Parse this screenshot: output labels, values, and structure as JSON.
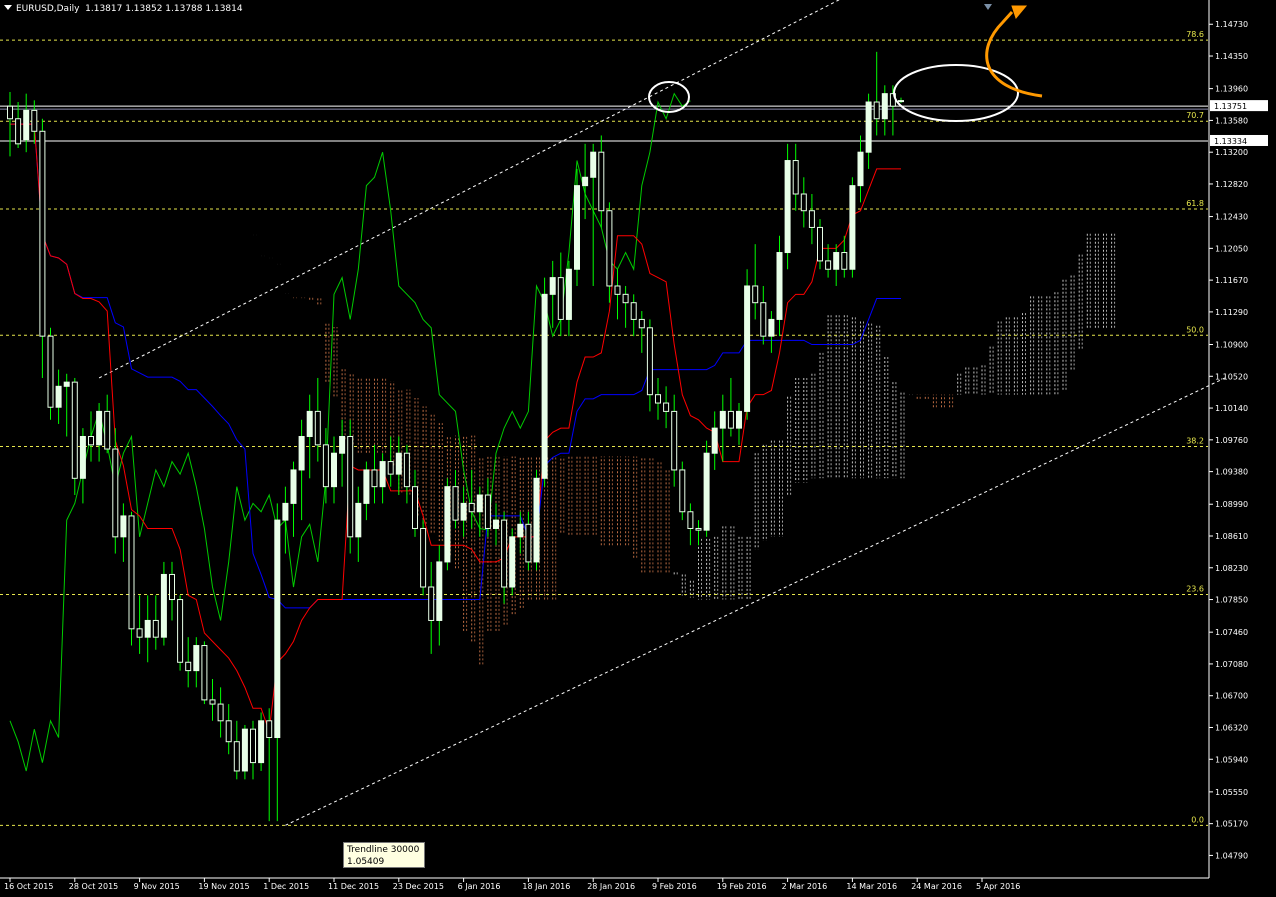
{
  "header": {
    "symbol": "EURUSD,Daily",
    "ohlc": "1.13817 1.13852 1.13788 1.13814"
  },
  "tooltip": {
    "name": "Trendline 30000",
    "value": "1.05409"
  },
  "colors": {
    "background": "#000000",
    "axis": "#ffffff",
    "candle_body": "#e8ffe8",
    "wick": "#00ff00",
    "tenkan": "#ff0000",
    "kijun": "#0000ff",
    "chikou": "#00cc00",
    "cloud": "#e8e8e8",
    "cloud_bear": "#e08050",
    "fib": "#e6e64c",
    "trendline": "#ffffff",
    "circle": "#ffffff",
    "arrow": "#ff9900"
  },
  "chart_data": {
    "type": "candlestick",
    "title": "EURUSD,Daily",
    "ohlc_last": [
      1.13817,
      1.13852,
      1.13788,
      1.13814
    ],
    "ylim": [
      1.0452,
      1.1502
    ],
    "y_ticks": [
      1.1473,
      1.1435,
      1.1396,
      1.1358,
      1.132,
      1.1282,
      1.1243,
      1.1205,
      1.1167,
      1.1129,
      1.109,
      1.1052,
      1.1014,
      1.0976,
      1.0938,
      1.0899,
      1.0861,
      1.0823,
      1.0785,
      1.0746,
      1.0708,
      1.067,
      1.0632,
      1.0594,
      1.0555,
      1.0517,
      1.0479
    ],
    "y_tick_labels": [
      "1.14730",
      "1.14350",
      "1.13960",
      "1.13580",
      "1.13200",
      "1.12820",
      "1.12430",
      "1.12050",
      "1.11670",
      "1.11290",
      "1.10900",
      "1.10520",
      "1.10140",
      "1.09760",
      "1.09380",
      "1.08990",
      "1.08610",
      "1.08230",
      "1.07850",
      "1.07460",
      "1.07080",
      "1.06700",
      "1.06320",
      "1.05940",
      "1.05550",
      "1.05170",
      "1.04790"
    ],
    "x_tick_labels": [
      "16 Oct 2015",
      "28 Oct 2015",
      "9 Nov 2015",
      "19 Nov 2015",
      "1 Dec 2015",
      "11 Dec 2015",
      "23 Dec 2015",
      "6 Jan 2016",
      "18 Jan 2016",
      "28 Jan 2016",
      "9 Feb 2016",
      "19 Feb 2016",
      "2 Mar 2016",
      "14 Mar 2016",
      "24 Mar 2016",
      "5 Apr 2016"
    ],
    "x_tick_bars": [
      0,
      8,
      16,
      24,
      32,
      40,
      48,
      56,
      64,
      72,
      80,
      88,
      96,
      104,
      112,
      120
    ],
    "price_labels": [
      {
        "value": 1.13751,
        "label": "1.13751"
      },
      {
        "value": 1.13334,
        "label": "1.13334"
      }
    ],
    "horizontal_lines": [
      1.13751,
      1.13334
    ],
    "fib_levels": [
      {
        "label": "78.6",
        "value": 1.1454
      },
      {
        "label": "70.7",
        "value": 1.1357
      },
      {
        "label": "61.8",
        "value": 1.1252
      },
      {
        "label": "50.0",
        "value": 1.1101
      },
      {
        "label": "38.2",
        "value": 1.0968
      },
      {
        "label": "23.6",
        "value": 1.0791
      },
      {
        "label": "0.0",
        "value": 1.0515
      }
    ],
    "trendlines": [
      {
        "name": "upper-channel",
        "x": [
          11,
          110
        ],
        "y": [
          1.105,
          1.154
        ]
      },
      {
        "name": "lower-channel",
        "x": [
          34,
          150
        ],
        "y": [
          1.0515,
          1.105
        ]
      }
    ],
    "candles": [
      {
        "o": 1.1375,
        "h": 1.1392,
        "l": 1.1315,
        "c": 1.136
      },
      {
        "o": 1.136,
        "h": 1.138,
        "l": 1.1325,
        "c": 1.133
      },
      {
        "o": 1.1335,
        "h": 1.139,
        "l": 1.132,
        "c": 1.137
      },
      {
        "o": 1.137,
        "h": 1.1382,
        "l": 1.133,
        "c": 1.1345
      },
      {
        "o": 1.1345,
        "h": 1.136,
        "l": 1.105,
        "c": 1.11
      },
      {
        "o": 1.11,
        "h": 1.111,
        "l": 1.1,
        "c": 1.1015
      },
      {
        "o": 1.1015,
        "h": 1.106,
        "l": 1.0995,
        "c": 1.104
      },
      {
        "o": 1.104,
        "h": 1.1055,
        "l": 1.098,
        "c": 1.1045
      },
      {
        "o": 1.1045,
        "h": 1.105,
        "l": 1.091,
        "c": 1.093
      },
      {
        "o": 1.093,
        "h": 1.099,
        "l": 1.09,
        "c": 1.098
      },
      {
        "o": 1.098,
        "h": 1.101,
        "l": 1.095,
        "c": 1.097
      },
      {
        "o": 1.097,
        "h": 1.102,
        "l": 1.095,
        "c": 1.101
      },
      {
        "o": 1.101,
        "h": 1.103,
        "l": 1.096,
        "c": 1.0965
      },
      {
        "o": 1.0965,
        "h": 1.099,
        "l": 1.084,
        "c": 1.086
      },
      {
        "o": 1.086,
        "h": 1.09,
        "l": 1.083,
        "c": 1.0885
      },
      {
        "o": 1.0885,
        "h": 1.089,
        "l": 1.073,
        "c": 1.075
      },
      {
        "o": 1.075,
        "h": 1.079,
        "l": 1.072,
        "c": 1.074
      },
      {
        "o": 1.074,
        "h": 1.079,
        "l": 1.071,
        "c": 1.076
      },
      {
        "o": 1.076,
        "h": 1.079,
        "l": 1.0725,
        "c": 1.074
      },
      {
        "o": 1.074,
        "h": 1.083,
        "l": 1.073,
        "c": 1.0815
      },
      {
        "o": 1.0815,
        "h": 1.083,
        "l": 1.076,
        "c": 1.0785
      },
      {
        "o": 1.0785,
        "h": 1.079,
        "l": 1.07,
        "c": 1.071
      },
      {
        "o": 1.071,
        "h": 1.074,
        "l": 1.068,
        "c": 1.07
      },
      {
        "o": 1.07,
        "h": 1.074,
        "l": 1.068,
        "c": 1.073
      },
      {
        "o": 1.073,
        "h": 1.0735,
        "l": 1.066,
        "c": 1.0665
      },
      {
        "o": 1.0665,
        "h": 1.069,
        "l": 1.064,
        "c": 1.066
      },
      {
        "o": 1.066,
        "h": 1.068,
        "l": 1.062,
        "c": 1.064
      },
      {
        "o": 1.064,
        "h": 1.066,
        "l": 1.06,
        "c": 1.0615
      },
      {
        "o": 1.0615,
        "h": 1.064,
        "l": 1.057,
        "c": 1.058
      },
      {
        "o": 1.058,
        "h": 1.0635,
        "l": 1.057,
        "c": 1.063
      },
      {
        "o": 1.063,
        "h": 1.064,
        "l": 1.057,
        "c": 1.059
      },
      {
        "o": 1.059,
        "h": 1.065,
        "l": 1.058,
        "c": 1.064
      },
      {
        "o": 1.064,
        "h": 1.0655,
        "l": 1.052,
        "c": 1.062
      },
      {
        "o": 1.062,
        "h": 1.09,
        "l": 1.052,
        "c": 1.088
      },
      {
        "o": 1.088,
        "h": 1.092,
        "l": 1.084,
        "c": 1.09
      },
      {
        "o": 1.09,
        "h": 1.095,
        "l": 1.086,
        "c": 1.094
      },
      {
        "o": 1.094,
        "h": 1.1,
        "l": 1.088,
        "c": 1.098
      },
      {
        "o": 1.098,
        "h": 1.103,
        "l": 1.093,
        "c": 1.101
      },
      {
        "o": 1.101,
        "h": 1.105,
        "l": 1.095,
        "c": 1.097
      },
      {
        "o": 1.097,
        "h": 1.099,
        "l": 1.09,
        "c": 1.092
      },
      {
        "o": 1.092,
        "h": 1.098,
        "l": 1.09,
        "c": 1.096
      },
      {
        "o": 1.096,
        "h": 1.1,
        "l": 1.092,
        "c": 1.098
      },
      {
        "o": 1.098,
        "h": 1.1,
        "l": 1.084,
        "c": 1.086
      },
      {
        "o": 1.086,
        "h": 1.092,
        "l": 1.083,
        "c": 1.09
      },
      {
        "o": 1.09,
        "h": 1.095,
        "l": 1.088,
        "c": 1.094
      },
      {
        "o": 1.094,
        "h": 1.097,
        "l": 1.09,
        "c": 1.092
      },
      {
        "o": 1.092,
        "h": 1.096,
        "l": 1.09,
        "c": 1.095
      },
      {
        "o": 1.095,
        "h": 1.098,
        "l": 1.092,
        "c": 1.0935
      },
      {
        "o": 1.0935,
        "h": 1.098,
        "l": 1.091,
        "c": 1.096
      },
      {
        "o": 1.096,
        "h": 1.097,
        "l": 1.09,
        "c": 1.092
      },
      {
        "o": 1.092,
        "h": 1.094,
        "l": 1.086,
        "c": 1.087
      },
      {
        "o": 1.087,
        "h": 1.088,
        "l": 1.079,
        "c": 1.08
      },
      {
        "o": 1.08,
        "h": 1.083,
        "l": 1.072,
        "c": 1.076
      },
      {
        "o": 1.076,
        "h": 1.085,
        "l": 1.073,
        "c": 1.083
      },
      {
        "o": 1.083,
        "h": 1.093,
        "l": 1.082,
        "c": 1.092
      },
      {
        "o": 1.092,
        "h": 1.094,
        "l": 1.087,
        "c": 1.088
      },
      {
        "o": 1.088,
        "h": 1.092,
        "l": 1.086,
        "c": 1.09
      },
      {
        "o": 1.09,
        "h": 1.094,
        "l": 1.087,
        "c": 1.089
      },
      {
        "o": 1.089,
        "h": 1.092,
        "l": 1.086,
        "c": 1.091
      },
      {
        "o": 1.091,
        "h": 1.093,
        "l": 1.086,
        "c": 1.087
      },
      {
        "o": 1.087,
        "h": 1.09,
        "l": 1.085,
        "c": 1.088
      },
      {
        "o": 1.088,
        "h": 1.089,
        "l": 1.078,
        "c": 1.08
      },
      {
        "o": 1.08,
        "h": 1.087,
        "l": 1.079,
        "c": 1.086
      },
      {
        "o": 1.086,
        "h": 1.089,
        "l": 1.084,
        "c": 1.0875
      },
      {
        "o": 1.0875,
        "h": 1.089,
        "l": 1.082,
        "c": 1.083
      },
      {
        "o": 1.083,
        "h": 1.094,
        "l": 1.082,
        "c": 1.093
      },
      {
        "o": 1.093,
        "h": 1.117,
        "l": 1.092,
        "c": 1.115
      },
      {
        "o": 1.115,
        "h": 1.119,
        "l": 1.111,
        "c": 1.117
      },
      {
        "o": 1.117,
        "h": 1.12,
        "l": 1.11,
        "c": 1.112
      },
      {
        "o": 1.112,
        "h": 1.119,
        "l": 1.11,
        "c": 1.118
      },
      {
        "o": 1.118,
        "h": 1.13,
        "l": 1.116,
        "c": 1.128
      },
      {
        "o": 1.128,
        "h": 1.133,
        "l": 1.124,
        "c": 1.129
      },
      {
        "o": 1.129,
        "h": 1.133,
        "l": 1.116,
        "c": 1.132
      },
      {
        "o": 1.132,
        "h": 1.134,
        "l": 1.123,
        "c": 1.125
      },
      {
        "o": 1.125,
        "h": 1.126,
        "l": 1.114,
        "c": 1.116
      },
      {
        "o": 1.116,
        "h": 1.118,
        "l": 1.112,
        "c": 1.115
      },
      {
        "o": 1.115,
        "h": 1.116,
        "l": 1.111,
        "c": 1.114
      },
      {
        "o": 1.114,
        "h": 1.115,
        "l": 1.11,
        "c": 1.112
      },
      {
        "o": 1.112,
        "h": 1.113,
        "l": 1.108,
        "c": 1.111
      },
      {
        "o": 1.111,
        "h": 1.112,
        "l": 1.101,
        "c": 1.103
      },
      {
        "o": 1.103,
        "h": 1.105,
        "l": 1.1,
        "c": 1.102
      },
      {
        "o": 1.102,
        "h": 1.104,
        "l": 1.099,
        "c": 1.101
      },
      {
        "o": 1.101,
        "h": 1.103,
        "l": 1.092,
        "c": 1.094
      },
      {
        "o": 1.094,
        "h": 1.095,
        "l": 1.088,
        "c": 1.089
      },
      {
        "o": 1.089,
        "h": 1.09,
        "l": 1.085,
        "c": 1.087
      },
      {
        "o": 1.087,
        "h": 1.088,
        "l": 1.085,
        "c": 1.0868
      },
      {
        "o": 1.0868,
        "h": 1.0975,
        "l": 1.086,
        "c": 1.096
      },
      {
        "o": 1.096,
        "h": 1.101,
        "l": 1.094,
        "c": 1.099
      },
      {
        "o": 1.099,
        "h": 1.103,
        "l": 1.095,
        "c": 1.101
      },
      {
        "o": 1.101,
        "h": 1.105,
        "l": 1.098,
        "c": 1.099
      },
      {
        "o": 1.099,
        "h": 1.102,
        "l": 1.097,
        "c": 1.101
      },
      {
        "o": 1.101,
        "h": 1.118,
        "l": 1.1,
        "c": 1.116
      },
      {
        "o": 1.116,
        "h": 1.121,
        "l": 1.112,
        "c": 1.114
      },
      {
        "o": 1.114,
        "h": 1.116,
        "l": 1.109,
        "c": 1.11
      },
      {
        "o": 1.11,
        "h": 1.113,
        "l": 1.108,
        "c": 1.112
      },
      {
        "o": 1.112,
        "h": 1.122,
        "l": 1.11,
        "c": 1.12
      },
      {
        "o": 1.12,
        "h": 1.133,
        "l": 1.118,
        "c": 1.131
      },
      {
        "o": 1.131,
        "h": 1.133,
        "l": 1.125,
        "c": 1.127
      },
      {
        "o": 1.127,
        "h": 1.129,
        "l": 1.123,
        "c": 1.125
      },
      {
        "o": 1.125,
        "h": 1.127,
        "l": 1.121,
        "c": 1.123
      },
      {
        "o": 1.123,
        "h": 1.124,
        "l": 1.118,
        "c": 1.119
      },
      {
        "o": 1.119,
        "h": 1.121,
        "l": 1.117,
        "c": 1.118
      },
      {
        "o": 1.118,
        "h": 1.121,
        "l": 1.116,
        "c": 1.12
      },
      {
        "o": 1.12,
        "h": 1.122,
        "l": 1.117,
        "c": 1.118
      },
      {
        "o": 1.118,
        "h": 1.129,
        "l": 1.117,
        "c": 1.128
      },
      {
        "o": 1.128,
        "h": 1.134,
        "l": 1.126,
        "c": 1.132
      },
      {
        "o": 1.132,
        "h": 1.139,
        "l": 1.13,
        "c": 1.138
      },
      {
        "o": 1.138,
        "h": 1.144,
        "l": 1.134,
        "c": 1.136
      },
      {
        "o": 1.136,
        "h": 1.14,
        "l": 1.134,
        "c": 1.139
      },
      {
        "o": 1.139,
        "h": 1.14,
        "l": 1.134,
        "c": 1.1375
      },
      {
        "o": 1.13817,
        "h": 1.13852,
        "l": 1.13788,
        "c": 1.13814
      }
    ]
  }
}
